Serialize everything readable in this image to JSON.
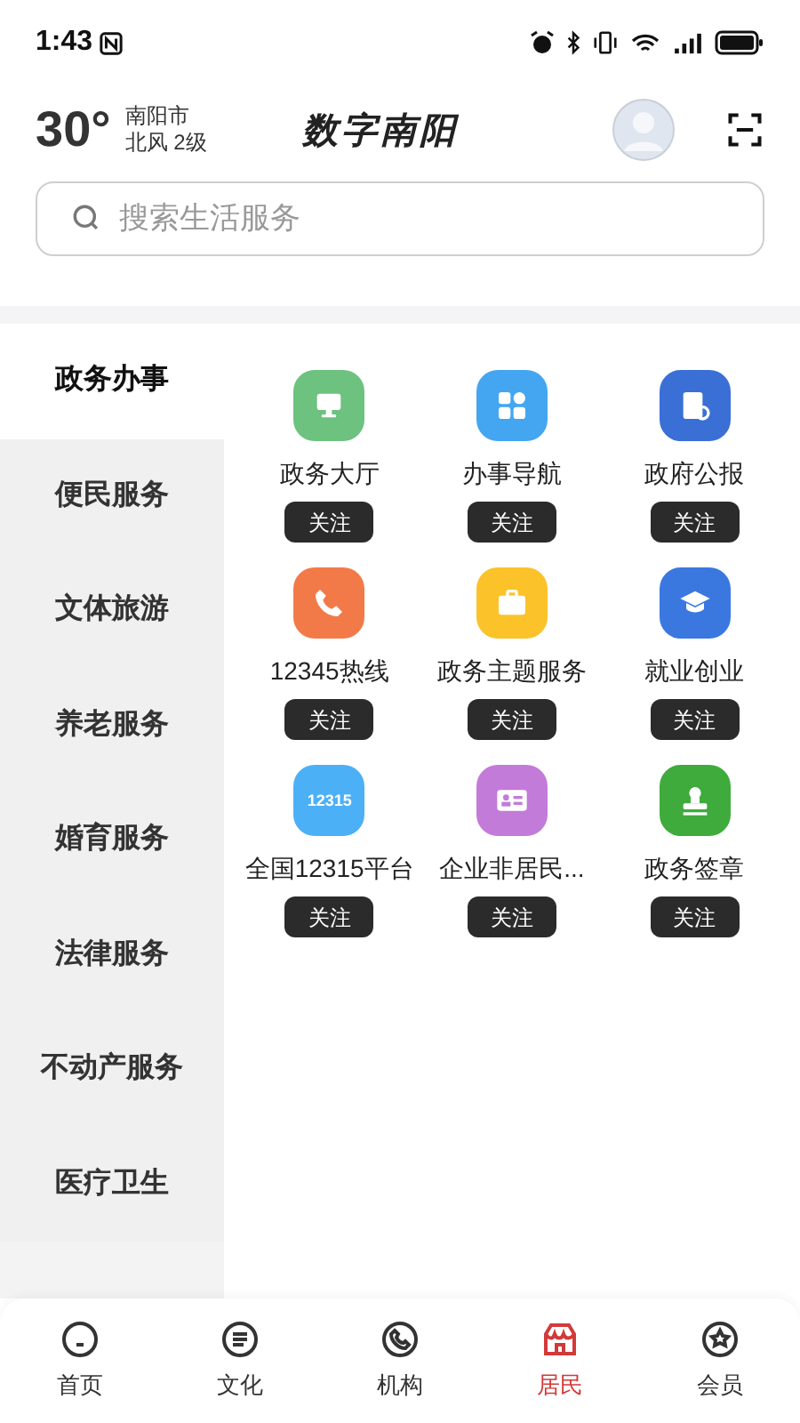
{
  "status_bar": {
    "time": "1:43"
  },
  "header": {
    "temperature": "30°",
    "city": "南阳市",
    "wind": "北风 2级",
    "title": "数字南阳"
  },
  "search": {
    "placeholder": "搜索生活服务"
  },
  "sidebar": {
    "items": [
      {
        "label": "政务办事",
        "selected": true
      },
      {
        "label": "便民服务",
        "selected": false
      },
      {
        "label": "文体旅游",
        "selected": false
      },
      {
        "label": "养老服务",
        "selected": false
      },
      {
        "label": "婚育服务",
        "selected": false
      },
      {
        "label": "法律服务",
        "selected": false
      },
      {
        "label": "不动产服务",
        "selected": false
      },
      {
        "label": "医疗卫生",
        "selected": false
      }
    ]
  },
  "services": [
    {
      "kind": "monitor",
      "label": "政务大厅",
      "color": "#6cc27e",
      "button": "关注"
    },
    {
      "kind": "grid",
      "label": "办事导航",
      "color": "#44a6f0",
      "button": "关注"
    },
    {
      "kind": "document",
      "label": "政府公报",
      "color": "#3a6fd6",
      "button": "关注"
    },
    {
      "kind": "phone",
      "label": "12345热线",
      "color": "#f27a48",
      "button": "关注"
    },
    {
      "kind": "briefcase",
      "label": "政务主题服务",
      "color": "#fbc22a",
      "button": "关注"
    },
    {
      "kind": "cap",
      "label": "就业创业",
      "color": "#3a78e0",
      "button": "关注"
    },
    {
      "kind": "badge",
      "label": "全国12315平台",
      "color": "#4cb0f6",
      "button": "关注",
      "icon_text": "12315"
    },
    {
      "kind": "card",
      "label": "企业非居民...",
      "color": "#c27bd9",
      "button": "关注"
    },
    {
      "kind": "stamp",
      "label": "政务签章",
      "color": "#3fab3c",
      "button": "关注"
    }
  ],
  "tab_bar": [
    {
      "kind": "home",
      "label": "首页",
      "selected": false
    },
    {
      "kind": "list",
      "label": "文化",
      "selected": false
    },
    {
      "kind": "phone",
      "label": "机构",
      "selected": false
    },
    {
      "kind": "shop",
      "label": "居民",
      "selected": true
    },
    {
      "kind": "star",
      "label": "会员",
      "selected": false
    }
  ]
}
